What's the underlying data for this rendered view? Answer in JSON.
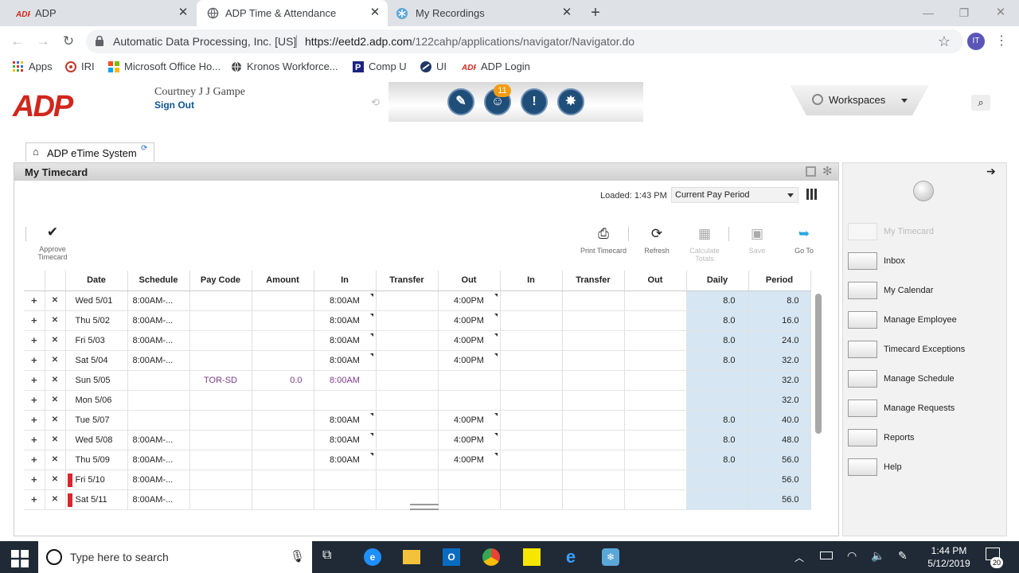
{
  "browser": {
    "tabs": [
      {
        "label": "ADP"
      },
      {
        "label": "ADP Time & Attendance"
      },
      {
        "label": "My Recordings"
      }
    ],
    "cert_name": "Automatic Data Processing, Inc. [US]",
    "url_host": "https://eetd2.adp.com",
    "url_path": "/122cahp/applications/navigator/Navigator.do",
    "profile_initials": "IT",
    "bookmarks": [
      {
        "label": "Apps"
      },
      {
        "label": "IRI"
      },
      {
        "label": "Microsoft Office Ho..."
      },
      {
        "label": "Kronos Workforce..."
      },
      {
        "label": "Comp U"
      },
      {
        "label": "UI"
      },
      {
        "label": "ADP Login"
      }
    ]
  },
  "header": {
    "logo": "ADP",
    "user_name": "Courtney J J Gampe",
    "sign_out": "Sign Out",
    "notification_count": "11",
    "workspaces_label": "Workspaces"
  },
  "etime_tab": {
    "label": "ADP eTime System"
  },
  "timecard": {
    "title": "My Timecard",
    "loaded": "Loaded: 1:43 PM",
    "period": "Current Pay Period",
    "toolbar": {
      "approve": "Approve Timecard",
      "print": "Print Timecard",
      "refresh": "Refresh",
      "calculate": "Calculate Totals",
      "save": "Save",
      "goto": "Go To"
    },
    "columns": [
      "Date",
      "Schedule",
      "Pay Code",
      "Amount",
      "In",
      "Transfer",
      "Out",
      "In",
      "Transfer",
      "Out",
      "Daily",
      "Period"
    ],
    "rows": [
      {
        "date": "Wed 5/01",
        "schedule": "8:00AM-...",
        "paycode": "",
        "amount": "",
        "in1": "8:00AM",
        "transfer1": "",
        "out1": "4:00PM",
        "in2": "",
        "transfer2": "",
        "out2": "",
        "daily": "8.0",
        "period": "8.0",
        "flag": false
      },
      {
        "date": "Thu 5/02",
        "schedule": "8:00AM-...",
        "paycode": "",
        "amount": "",
        "in1": "8:00AM",
        "transfer1": "",
        "out1": "4:00PM",
        "in2": "",
        "transfer2": "",
        "out2": "",
        "daily": "8.0",
        "period": "16.0",
        "flag": false
      },
      {
        "date": "Fri 5/03",
        "schedule": "8:00AM-...",
        "paycode": "",
        "amount": "",
        "in1": "8:00AM",
        "transfer1": "",
        "out1": "4:00PM",
        "in2": "",
        "transfer2": "",
        "out2": "",
        "daily": "8.0",
        "period": "24.0",
        "flag": false
      },
      {
        "date": "Sat 5/04",
        "schedule": "8:00AM-...",
        "paycode": "",
        "amount": "",
        "in1": "8:00AM",
        "transfer1": "",
        "out1": "4:00PM",
        "in2": "",
        "transfer2": "",
        "out2": "",
        "daily": "8.0",
        "period": "32.0",
        "flag": false
      },
      {
        "date": "Sun 5/05",
        "schedule": "",
        "paycode": "TOR-SD",
        "amount": "0.0",
        "in1": "8:00AM",
        "transfer1": "",
        "out1": "",
        "in2": "",
        "transfer2": "",
        "out2": "",
        "daily": "",
        "period": "32.0",
        "flag": false
      },
      {
        "date": "Mon 5/06",
        "schedule": "",
        "paycode": "",
        "amount": "",
        "in1": "",
        "transfer1": "",
        "out1": "",
        "in2": "",
        "transfer2": "",
        "out2": "",
        "daily": "",
        "period": "32.0",
        "flag": false
      },
      {
        "date": "Tue 5/07",
        "schedule": "",
        "paycode": "",
        "amount": "",
        "in1": "8:00AM",
        "transfer1": "",
        "out1": "4:00PM",
        "in2": "",
        "transfer2": "",
        "out2": "",
        "daily": "8.0",
        "period": "40.0",
        "flag": false
      },
      {
        "date": "Wed 5/08",
        "schedule": "8:00AM-...",
        "paycode": "",
        "amount": "",
        "in1": "8:00AM",
        "transfer1": "",
        "out1": "4:00PM",
        "in2": "",
        "transfer2": "",
        "out2": "",
        "daily": "8.0",
        "period": "48.0",
        "flag": false
      },
      {
        "date": "Thu 5/09",
        "schedule": "8:00AM-...",
        "paycode": "",
        "amount": "",
        "in1": "8:00AM",
        "transfer1": "",
        "out1": "4:00PM",
        "in2": "",
        "transfer2": "",
        "out2": "",
        "daily": "8.0",
        "period": "56.0",
        "flag": false
      },
      {
        "date": "Fri 5/10",
        "schedule": "8:00AM-...",
        "paycode": "",
        "amount": "",
        "in1": "",
        "transfer1": "",
        "out1": "",
        "in2": "",
        "transfer2": "",
        "out2": "",
        "daily": "",
        "period": "56.0",
        "flag": true
      },
      {
        "date": "Sat 5/11",
        "schedule": "8:00AM-...",
        "paycode": "",
        "amount": "",
        "in1": "",
        "transfer1": "",
        "out1": "",
        "in2": "",
        "transfer2": "",
        "out2": "",
        "daily": "",
        "period": "56.0",
        "flag": true
      }
    ]
  },
  "sidebar": {
    "items": [
      {
        "label": "My Timecard",
        "disabled": true
      },
      {
        "label": "Inbox"
      },
      {
        "label": "My Calendar"
      },
      {
        "label": "Manage Employee"
      },
      {
        "label": "Timecard Exceptions"
      },
      {
        "label": "Manage Schedule"
      },
      {
        "label": "Manage Requests"
      },
      {
        "label": "Reports"
      },
      {
        "label": "Help"
      }
    ]
  },
  "taskbar": {
    "search_placeholder": "Type here to search",
    "time": "1:44 PM",
    "date": "5/12/2019",
    "notifications": "20"
  },
  "colors": {
    "adp_red": "#d0271d",
    "total_bg": "#d6e6f2",
    "paycode_purple": "#7f3a8a"
  }
}
